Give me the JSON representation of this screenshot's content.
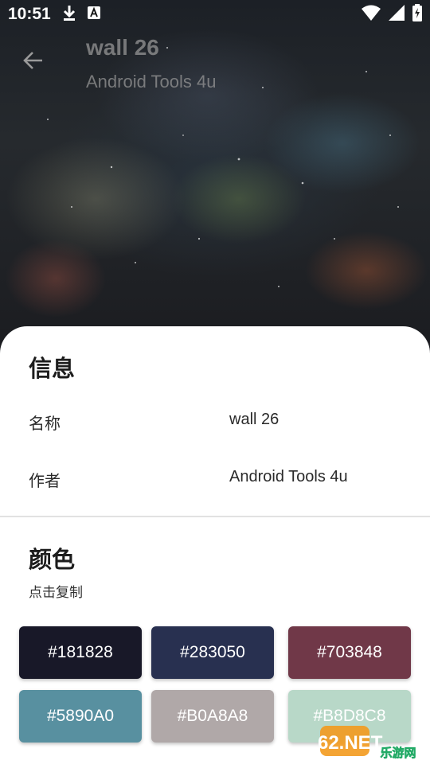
{
  "status_bar": {
    "time": "10:51",
    "icons": [
      "download-icon",
      "app-notification-icon",
      "wifi-icon",
      "signal-icon",
      "battery-icon"
    ]
  },
  "header": {
    "title": "wall 26",
    "subtitle": "Android Tools 4u",
    "back_icon": "arrow-left-icon"
  },
  "info": {
    "title": "信息",
    "rows": [
      {
        "label": "名称",
        "value": "wall 26"
      },
      {
        "label": "作者",
        "value": "Android Tools 4u"
      }
    ]
  },
  "colors": {
    "title": "颜色",
    "hint": "点击复制",
    "swatches": [
      {
        "label": "#181828",
        "color": "#181828"
      },
      {
        "label": "#283050",
        "color": "#283050"
      },
      {
        "label": "#703848",
        "color": "#703848"
      },
      {
        "label": "#5890A0",
        "color": "#5890A0"
      },
      {
        "label": "#B0A8A8",
        "color": "#B0A8A8"
      },
      {
        "label": "#B8D8C8",
        "color": "#B8D8C8"
      }
    ]
  },
  "watermark": {
    "top": "962.NET",
    "bottom": "乐游网"
  }
}
